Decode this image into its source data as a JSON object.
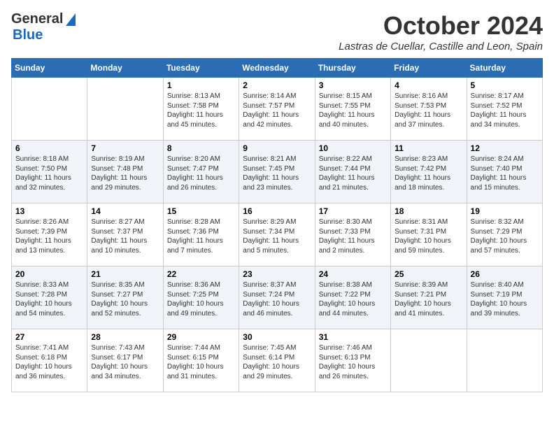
{
  "header": {
    "logo_line1": "General",
    "logo_line2": "Blue",
    "title": "October 2024",
    "subtitle": "Lastras de Cuellar, Castille and Leon, Spain"
  },
  "calendar": {
    "weekdays": [
      "Sunday",
      "Monday",
      "Tuesday",
      "Wednesday",
      "Thursday",
      "Friday",
      "Saturday"
    ],
    "weeks": [
      [
        {
          "day": null,
          "detail": ""
        },
        {
          "day": null,
          "detail": ""
        },
        {
          "day": "1",
          "detail": "Sunrise: 8:13 AM\nSunset: 7:58 PM\nDaylight: 11 hours and 45 minutes."
        },
        {
          "day": "2",
          "detail": "Sunrise: 8:14 AM\nSunset: 7:57 PM\nDaylight: 11 hours and 42 minutes."
        },
        {
          "day": "3",
          "detail": "Sunrise: 8:15 AM\nSunset: 7:55 PM\nDaylight: 11 hours and 40 minutes."
        },
        {
          "day": "4",
          "detail": "Sunrise: 8:16 AM\nSunset: 7:53 PM\nDaylight: 11 hours and 37 minutes."
        },
        {
          "day": "5",
          "detail": "Sunrise: 8:17 AM\nSunset: 7:52 PM\nDaylight: 11 hours and 34 minutes."
        }
      ],
      [
        {
          "day": "6",
          "detail": "Sunrise: 8:18 AM\nSunset: 7:50 PM\nDaylight: 11 hours and 32 minutes."
        },
        {
          "day": "7",
          "detail": "Sunrise: 8:19 AM\nSunset: 7:48 PM\nDaylight: 11 hours and 29 minutes."
        },
        {
          "day": "8",
          "detail": "Sunrise: 8:20 AM\nSunset: 7:47 PM\nDaylight: 11 hours and 26 minutes."
        },
        {
          "day": "9",
          "detail": "Sunrise: 8:21 AM\nSunset: 7:45 PM\nDaylight: 11 hours and 23 minutes."
        },
        {
          "day": "10",
          "detail": "Sunrise: 8:22 AM\nSunset: 7:44 PM\nDaylight: 11 hours and 21 minutes."
        },
        {
          "day": "11",
          "detail": "Sunrise: 8:23 AM\nSunset: 7:42 PM\nDaylight: 11 hours and 18 minutes."
        },
        {
          "day": "12",
          "detail": "Sunrise: 8:24 AM\nSunset: 7:40 PM\nDaylight: 11 hours and 15 minutes."
        }
      ],
      [
        {
          "day": "13",
          "detail": "Sunrise: 8:26 AM\nSunset: 7:39 PM\nDaylight: 11 hours and 13 minutes."
        },
        {
          "day": "14",
          "detail": "Sunrise: 8:27 AM\nSunset: 7:37 PM\nDaylight: 11 hours and 10 minutes."
        },
        {
          "day": "15",
          "detail": "Sunrise: 8:28 AM\nSunset: 7:36 PM\nDaylight: 11 hours and 7 minutes."
        },
        {
          "day": "16",
          "detail": "Sunrise: 8:29 AM\nSunset: 7:34 PM\nDaylight: 11 hours and 5 minutes."
        },
        {
          "day": "17",
          "detail": "Sunrise: 8:30 AM\nSunset: 7:33 PM\nDaylight: 11 hours and 2 minutes."
        },
        {
          "day": "18",
          "detail": "Sunrise: 8:31 AM\nSunset: 7:31 PM\nDaylight: 10 hours and 59 minutes."
        },
        {
          "day": "19",
          "detail": "Sunrise: 8:32 AM\nSunset: 7:29 PM\nDaylight: 10 hours and 57 minutes."
        }
      ],
      [
        {
          "day": "20",
          "detail": "Sunrise: 8:33 AM\nSunset: 7:28 PM\nDaylight: 10 hours and 54 minutes."
        },
        {
          "day": "21",
          "detail": "Sunrise: 8:35 AM\nSunset: 7:27 PM\nDaylight: 10 hours and 52 minutes."
        },
        {
          "day": "22",
          "detail": "Sunrise: 8:36 AM\nSunset: 7:25 PM\nDaylight: 10 hours and 49 minutes."
        },
        {
          "day": "23",
          "detail": "Sunrise: 8:37 AM\nSunset: 7:24 PM\nDaylight: 10 hours and 46 minutes."
        },
        {
          "day": "24",
          "detail": "Sunrise: 8:38 AM\nSunset: 7:22 PM\nDaylight: 10 hours and 44 minutes."
        },
        {
          "day": "25",
          "detail": "Sunrise: 8:39 AM\nSunset: 7:21 PM\nDaylight: 10 hours and 41 minutes."
        },
        {
          "day": "26",
          "detail": "Sunrise: 8:40 AM\nSunset: 7:19 PM\nDaylight: 10 hours and 39 minutes."
        }
      ],
      [
        {
          "day": "27",
          "detail": "Sunrise: 7:41 AM\nSunset: 6:18 PM\nDaylight: 10 hours and 36 minutes."
        },
        {
          "day": "28",
          "detail": "Sunrise: 7:43 AM\nSunset: 6:17 PM\nDaylight: 10 hours and 34 minutes."
        },
        {
          "day": "29",
          "detail": "Sunrise: 7:44 AM\nSunset: 6:15 PM\nDaylight: 10 hours and 31 minutes."
        },
        {
          "day": "30",
          "detail": "Sunrise: 7:45 AM\nSunset: 6:14 PM\nDaylight: 10 hours and 29 minutes."
        },
        {
          "day": "31",
          "detail": "Sunrise: 7:46 AM\nSunset: 6:13 PM\nDaylight: 10 hours and 26 minutes."
        },
        {
          "day": null,
          "detail": ""
        },
        {
          "day": null,
          "detail": ""
        }
      ]
    ]
  }
}
